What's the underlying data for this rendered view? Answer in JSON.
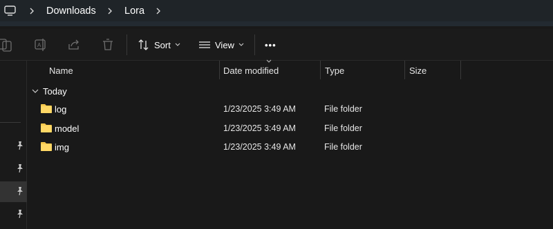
{
  "address_bar": {
    "breadcrumbs": [
      "Downloads",
      "Lora"
    ],
    "icon": "computer-icon"
  },
  "toolbar": {
    "sort_label": "Sort",
    "view_label": "View",
    "more_label": "•••",
    "icons": [
      "copy-icon",
      "rename-icon",
      "share-icon",
      "delete-icon",
      "sort-icon",
      "view-icon",
      "more-icon"
    ]
  },
  "columns": {
    "name": "Name",
    "date_modified": "Date modified",
    "type": "Type",
    "size": "Size"
  },
  "groups": [
    {
      "label": "Today",
      "items": [
        {
          "name": "log",
          "date": "1/23/2025 3:49 AM",
          "type": "File folder",
          "size": ""
        },
        {
          "name": "model",
          "date": "1/23/2025 3:49 AM",
          "type": "File folder",
          "size": ""
        },
        {
          "name": "img",
          "date": "1/23/2025 3:49 AM",
          "type": "File folder",
          "size": ""
        }
      ]
    }
  ],
  "colors": {
    "background": "#191919",
    "address_bar": "#1f2428",
    "folder": "#f6c94e",
    "text": "#ffffff"
  }
}
